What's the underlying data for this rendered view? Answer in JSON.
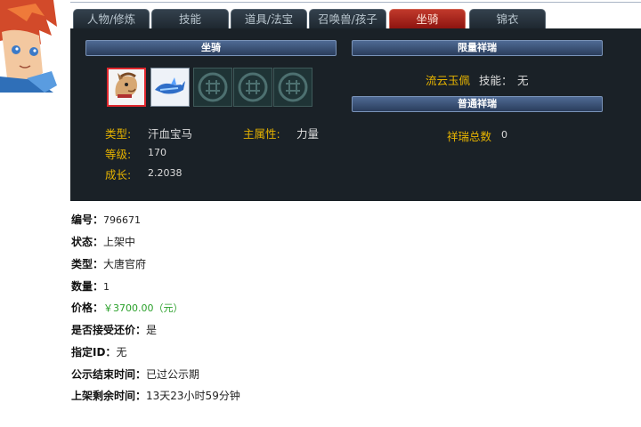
{
  "tabs": [
    {
      "label": "人物/修炼"
    },
    {
      "label": "技能"
    },
    {
      "label": "道具/法宝"
    },
    {
      "label": "召唤兽/孩子"
    },
    {
      "label": "坐骑"
    },
    {
      "label": "锦衣"
    }
  ],
  "panel": {
    "mount_header": "坐骑",
    "limited_header": "限量祥瑞",
    "normal_header": "普通祥瑞",
    "limited_item": {
      "name": "流云玉佩",
      "skill_label": "技能：",
      "skill_value": "无"
    },
    "mount": {
      "type_label": "类型:",
      "type_value": "汗血宝马",
      "attr_label": "主属性:",
      "attr_value": "力量",
      "level_label": "等级:",
      "level_value": "170",
      "growth_label": "成长:",
      "growth_value": "2.2038"
    },
    "normal_total": {
      "label": "祥瑞总数",
      "value": "0"
    }
  },
  "details": {
    "id": {
      "label": "编号：",
      "value": "796671"
    },
    "status": {
      "label": "状态：",
      "value": "上架中"
    },
    "type": {
      "label": "类型：",
      "value": "大唐官府"
    },
    "quantity": {
      "label": "数量：",
      "value": "1"
    },
    "price": {
      "label": "价格：",
      "value": "￥3700.00（元）"
    },
    "counter_offer": {
      "label": "是否接受还价：",
      "value": "是"
    },
    "designated_id": {
      "label": "指定ID：",
      "value": "无"
    },
    "publicity_end": {
      "label": "公示结束时间：",
      "value": "已过公示期"
    },
    "remaining": {
      "label": "上架剩余时间：",
      "value": "13天23小时59分钟"
    }
  },
  "colors": {
    "panel_bg": "#1a2127",
    "active_tab": "#b82a1f",
    "label_gold": "#e7b400",
    "price_green": "#2aa02a"
  }
}
